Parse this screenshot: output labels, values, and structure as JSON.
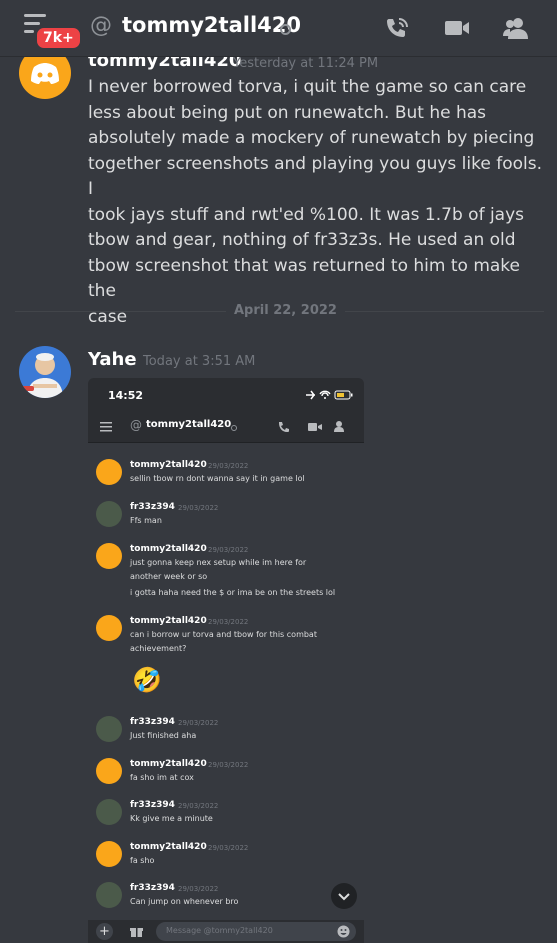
{
  "header": {
    "badge": "7k+",
    "at_symbol": "@",
    "title": "tommy2tall420",
    "icons": [
      "menu-icon",
      "phone-icon",
      "video-icon",
      "members-icon"
    ]
  },
  "messages": [
    {
      "author": "tommy2tall420",
      "timestamp": "Yesterday at 11:24 PM",
      "lines": [
        "I never borrowed torva, i quit the game so can care",
        "less about being put on runewatch. But he has",
        "absolutely made a mockery of runewatch by piecing",
        "together screenshots and playing you guys like fools. I",
        "took jays stuff and rwt'ed %100. It was 1.7b of jays",
        "tbow and gear, nothing of fr33z3s. He used an old",
        "tbow screenshot that was returned to him to make the",
        "case"
      ]
    },
    {
      "author": "Yahe",
      "timestamp": "Today at 3:51 AM"
    }
  ],
  "date_divider": "April 22, 2022",
  "screenshot": {
    "time": "14:52",
    "channel": "tommy2tall420",
    "input_placeholder": "Message @tommy2tall420",
    "messages": [
      {
        "author": "tommy2tall420",
        "ts": "29/03/2022",
        "avatar": "discord",
        "lines": [
          "sellin tbow rn dont wanna say it in game lol"
        ]
      },
      {
        "author": "fr33z394",
        "ts": "29/03/2022",
        "avatar": "photo",
        "lines": [
          "Ffs man"
        ]
      },
      {
        "author": "tommy2tall420",
        "ts": "29/03/2022",
        "avatar": "discord",
        "lines": [
          "just gonna keep nex setup while im here for",
          "another week or so",
          "i gotta haha need the $ or ima be on the streets lol"
        ]
      },
      {
        "author": "tommy2tall420",
        "ts": "29/03/2022",
        "avatar": "discord",
        "lines": [
          "can i borrow ur torva and tbow for this combat",
          "achievement?"
        ]
      },
      {
        "author": "fr33z394",
        "ts": "29/03/2022",
        "avatar": "photo",
        "lines": [
          "Just finished aha"
        ]
      },
      {
        "author": "tommy2tall420",
        "ts": "29/03/2022",
        "avatar": "discord",
        "lines": [
          "fa sho im at cox"
        ]
      },
      {
        "author": "fr33z394",
        "ts": "29/03/2022",
        "avatar": "photo",
        "lines": [
          "Kk give me a minute"
        ]
      },
      {
        "author": "tommy2tall420",
        "ts": "29/03/2022",
        "avatar": "discord",
        "lines": [
          "fa sho"
        ]
      },
      {
        "author": "fr33z394",
        "ts": "29/03/2022",
        "avatar": "photo",
        "lines": [
          "Can jump on whenever bro"
        ]
      }
    ],
    "emoji": "🤣"
  },
  "colors": {
    "background": "#36393f",
    "discord_avatar": "#faa61a",
    "badge": "#ed4245"
  }
}
